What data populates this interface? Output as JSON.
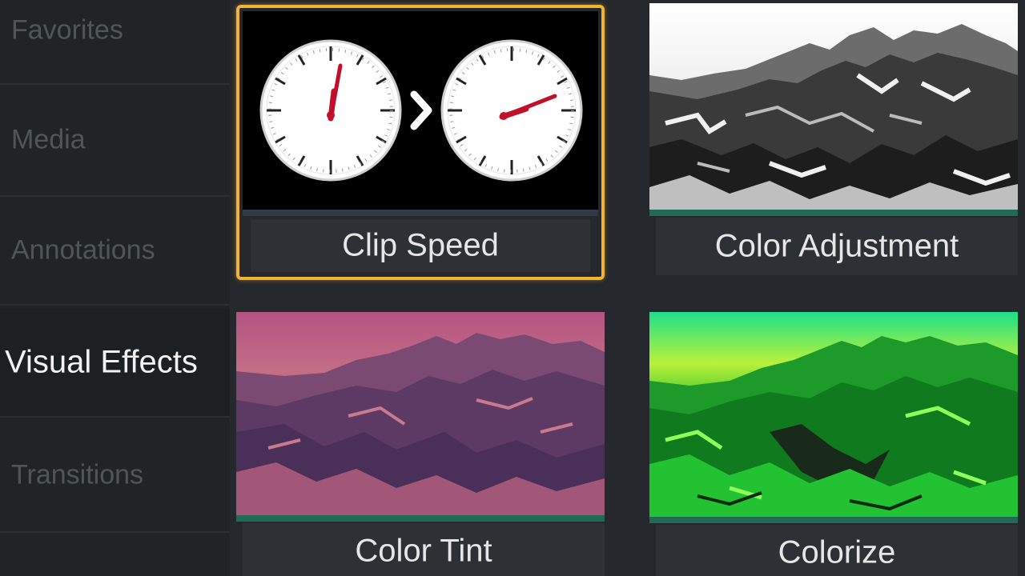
{
  "sidebar": {
    "items": [
      {
        "label": "Favorites"
      },
      {
        "label": "Media"
      },
      {
        "label": "Annotations"
      },
      {
        "label": "Visual Effects"
      },
      {
        "label": "Transitions"
      }
    ],
    "active_index": 3
  },
  "effects": [
    {
      "label": "Clip Speed",
      "selected": true,
      "thumb": "dual-clock-icon"
    },
    {
      "label": "Color Adjustment",
      "selected": false,
      "thumb": "mountain-grayscale"
    },
    {
      "label": "Color Tint",
      "selected": false,
      "thumb": "mountain-magenta"
    },
    {
      "label": "Colorize",
      "selected": false,
      "thumb": "mountain-green"
    }
  ],
  "colors": {
    "selection_border": "#f2b233",
    "thumb_underline": "#1f6b53",
    "sidebar_active_text": "#f2f2f2",
    "sidebar_inactive_text": "#4e565a"
  }
}
